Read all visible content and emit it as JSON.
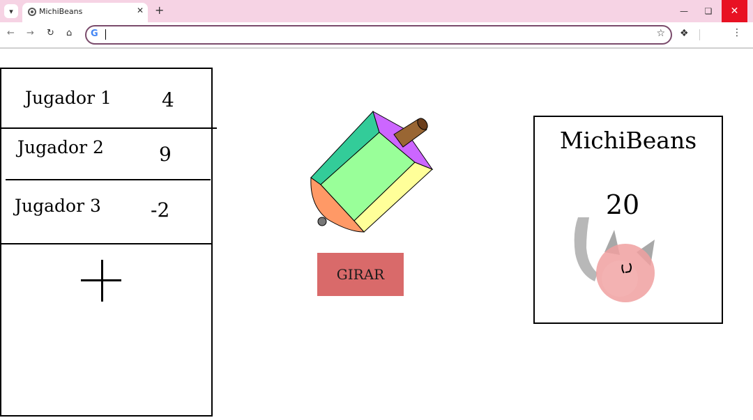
{
  "browser": {
    "tab_title": "MichiBeans",
    "new_tab_symbol": "+",
    "url": "",
    "icons": {
      "tab_list": "chevron-down-icon",
      "favicon": "globe-icon",
      "close_tab": "close-icon",
      "back": "arrow-left-icon",
      "forward": "arrow-right-icon",
      "reload": "reload-icon",
      "home": "home-icon",
      "search_engine": "google-icon",
      "bookmark": "star-icon",
      "extensions": "puzzle-icon",
      "menu": "more-vert-icon",
      "minimize": "minimize-icon",
      "restore": "restore-icon",
      "close_window": "close-window-icon"
    },
    "colors": {
      "titlebar": "#f6d3e4",
      "omnibox_border": "#7a4b6b",
      "close_window": "#e81123"
    }
  },
  "game": {
    "players": [
      {
        "name": "Jugador 1",
        "score": "4"
      },
      {
        "name": "Jugador 2",
        "score": "9"
      },
      {
        "name": "Jugador 3",
        "score": "-2"
      }
    ],
    "add_player_icon": "plus-icon",
    "spin_button_label": "GIRAR",
    "spinner_icon": "spinning-top-icon",
    "bank": {
      "title": "MichiBeans",
      "count": "20",
      "image_icon": "cat-drawing-icon"
    },
    "colors": {
      "spin_button": "#d96a6a",
      "top_face_purple": "#cc66ff",
      "top_side_teal": "#33cc99",
      "top_side_green": "#99ff99",
      "top_side_yellow": "#ffff99",
      "top_bottom_orange": "#ff9966",
      "top_handle_brown": "#996633",
      "cat_pink": "#f0a0a0",
      "cat_gray": "#b8b8b8"
    }
  }
}
